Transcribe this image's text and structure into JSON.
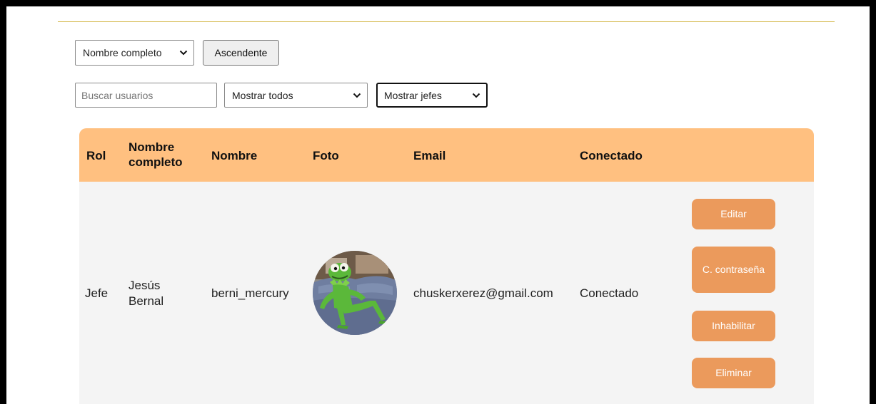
{
  "controls": {
    "sort_field": "Nombre completo",
    "sort_order_button": "Ascendente",
    "search_placeholder": "Buscar usuarios",
    "status_filter": "Mostrar todos",
    "role_filter": "Mostrar jefes"
  },
  "table": {
    "headers": {
      "rol": "Rol",
      "nombre_completo": "Nombre completo",
      "nombre": "Nombre",
      "foto": "Foto",
      "email": "Email",
      "conectado": "Conectado"
    },
    "rows": [
      {
        "rol": "Jefe",
        "nombre_completo": "Jesús Bernal",
        "nombre": "berni_mercury",
        "foto": "kermit-avatar",
        "email": "chuskerxerez@gmail.com",
        "conectado": "Conectado",
        "actions": {
          "edit": "Editar",
          "change_password": "C. contraseña",
          "disable": "Inhabilitar",
          "delete": "Eliminar"
        }
      }
    ]
  },
  "colors": {
    "header_bg": "#ffc080",
    "action_button": "#eb9a5c",
    "row_bg": "#f4f4f4",
    "divider": "#d4b84a"
  }
}
